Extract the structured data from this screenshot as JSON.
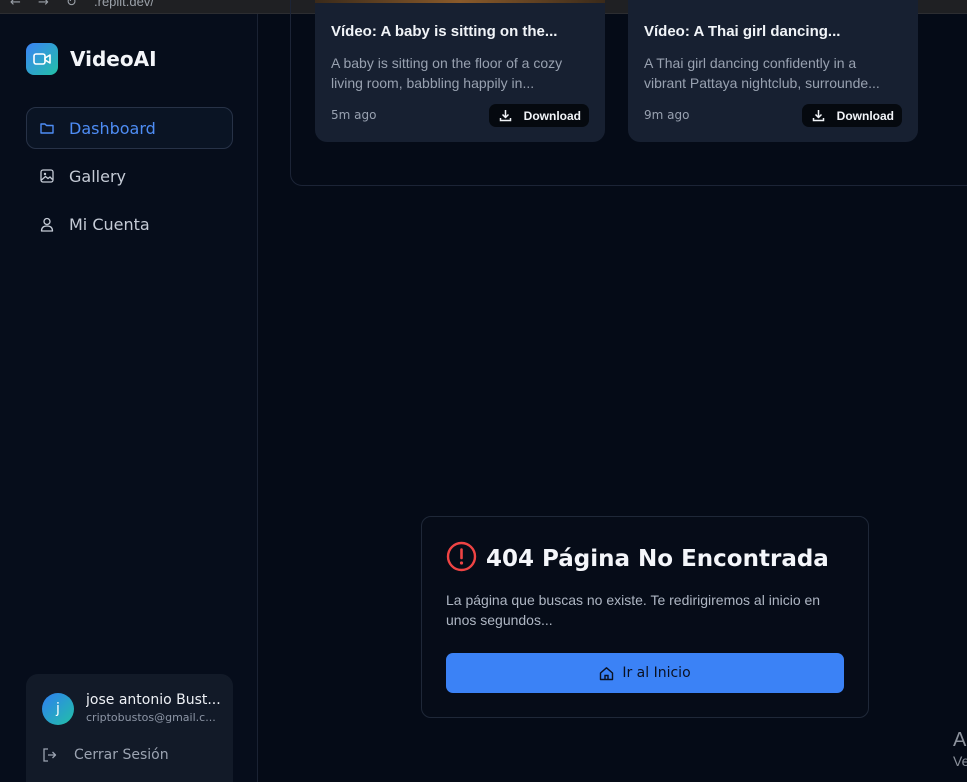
{
  "browser": {
    "url": ".replit.dev/"
  },
  "brand": {
    "name": "VideoAI",
    "logo_icon": "video-camera-icon"
  },
  "sidebar": {
    "items": [
      {
        "label": "Dashboard",
        "icon": "folder-icon",
        "active": true
      },
      {
        "label": "Gallery",
        "icon": "image-icon",
        "active": false
      },
      {
        "label": "Mi Cuenta",
        "icon": "user-icon",
        "active": false
      }
    ]
  },
  "user": {
    "initial": "j",
    "name": "jose antonio Bust...",
    "email": "criptobustos@gmail.c...",
    "logout_label": "Cerrar Sesión"
  },
  "videos": [
    {
      "title": "Vídeo: A baby is sitting on the...",
      "desc_line1": "A baby is sitting on the floor of a cozy",
      "desc_line2": "living room, babbling happily in...",
      "time": "5m ago",
      "download_label": "Download"
    },
    {
      "title": "Vídeo: A Thai girl dancing...",
      "desc_line1": "A Thai girl dancing confidently in a",
      "desc_line2": "vibrant Pattaya nightclub, surrounde...",
      "time": "9m ago",
      "download_label": "Download"
    }
  ],
  "not_found": {
    "title": "404 Página No Encontrada",
    "message": "La página que buscas no existe. Te redirigiremos al inicio en unos segundos...",
    "button_label": "Ir al Inicio",
    "accent": "#3b82f6",
    "alert_color": "#ef4444"
  },
  "corner_fragment": {
    "line1": "A",
    "line2": "Ve"
  }
}
